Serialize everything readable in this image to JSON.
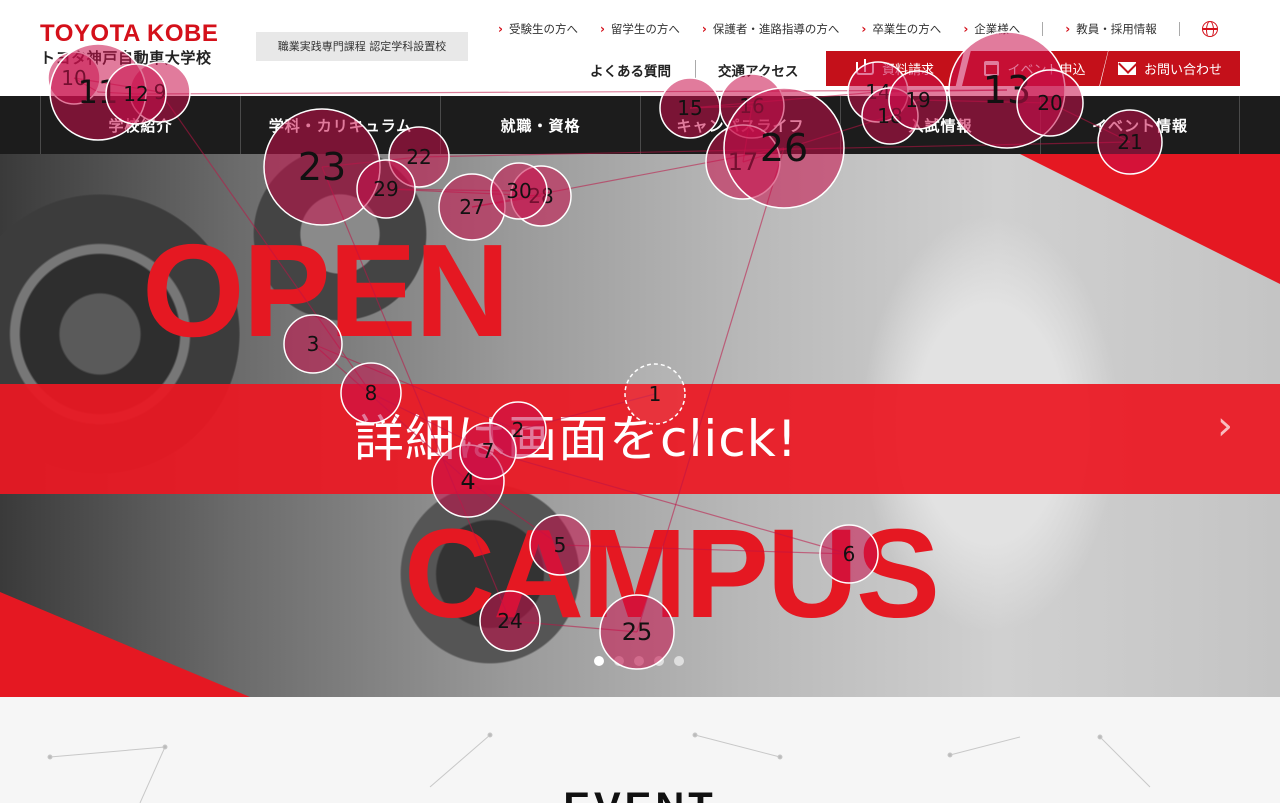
{
  "brand": {
    "logo_en": "TOYOTA KOBE",
    "logo_ja": "トヨタ神戸自動車大学校",
    "certification": "職業実践専門課程 認定学科設置校"
  },
  "top_links": [
    {
      "label": "受験生の方へ"
    },
    {
      "label": "留学生の方へ"
    },
    {
      "label": "保護者・進路指導の方へ"
    },
    {
      "label": "卒業生の方へ"
    },
    {
      "label": "企業様へ"
    },
    {
      "label": "教員・採用情報"
    }
  ],
  "mid_links": {
    "faq": "よくある質問",
    "access": "交通アクセス"
  },
  "cta": {
    "docs": "資料請求",
    "event": "イベント申込",
    "contact": "お問い合わせ"
  },
  "main_nav": [
    "学校紹介",
    "学科・カリキュラム",
    "就職・資格",
    "キャンパスライフ",
    "入試情報",
    "イベント情報"
  ],
  "hero": {
    "line1": "OPEN",
    "line2": "詳細は画面をclick!",
    "line3": "CAMPUS",
    "next_glyph": "›"
  },
  "event_section": {
    "title": "EVENT"
  },
  "colors": {
    "accent": "#d4101a",
    "nav_bg": "#1c1c1c",
    "hero_red": "#e51822"
  },
  "icons": [
    "book-icon",
    "calendar-icon",
    "mail-icon",
    "globe-icon",
    "chevron-right-icon"
  ],
  "overlay": {
    "markers": [
      {
        "n": "1",
        "dashed": true
      },
      {
        "n": "2"
      },
      {
        "n": "3"
      },
      {
        "n": "4"
      },
      {
        "n": "5"
      },
      {
        "n": "6"
      },
      {
        "n": "7"
      },
      {
        "n": "8"
      },
      {
        "n": "9"
      },
      {
        "n": "10"
      },
      {
        "n": "11"
      },
      {
        "n": "12"
      },
      {
        "n": "13"
      },
      {
        "n": "14"
      },
      {
        "n": "15"
      },
      {
        "n": "16"
      },
      {
        "n": "17"
      },
      {
        "n": "18"
      },
      {
        "n": "19"
      },
      {
        "n": "20"
      },
      {
        "n": "21"
      },
      {
        "n": "22"
      },
      {
        "n": "23"
      },
      {
        "n": "24"
      },
      {
        "n": "25"
      },
      {
        "n": "26"
      },
      {
        "n": "27"
      },
      {
        "n": "28"
      },
      {
        "n": "29"
      },
      {
        "n": "30"
      }
    ]
  }
}
